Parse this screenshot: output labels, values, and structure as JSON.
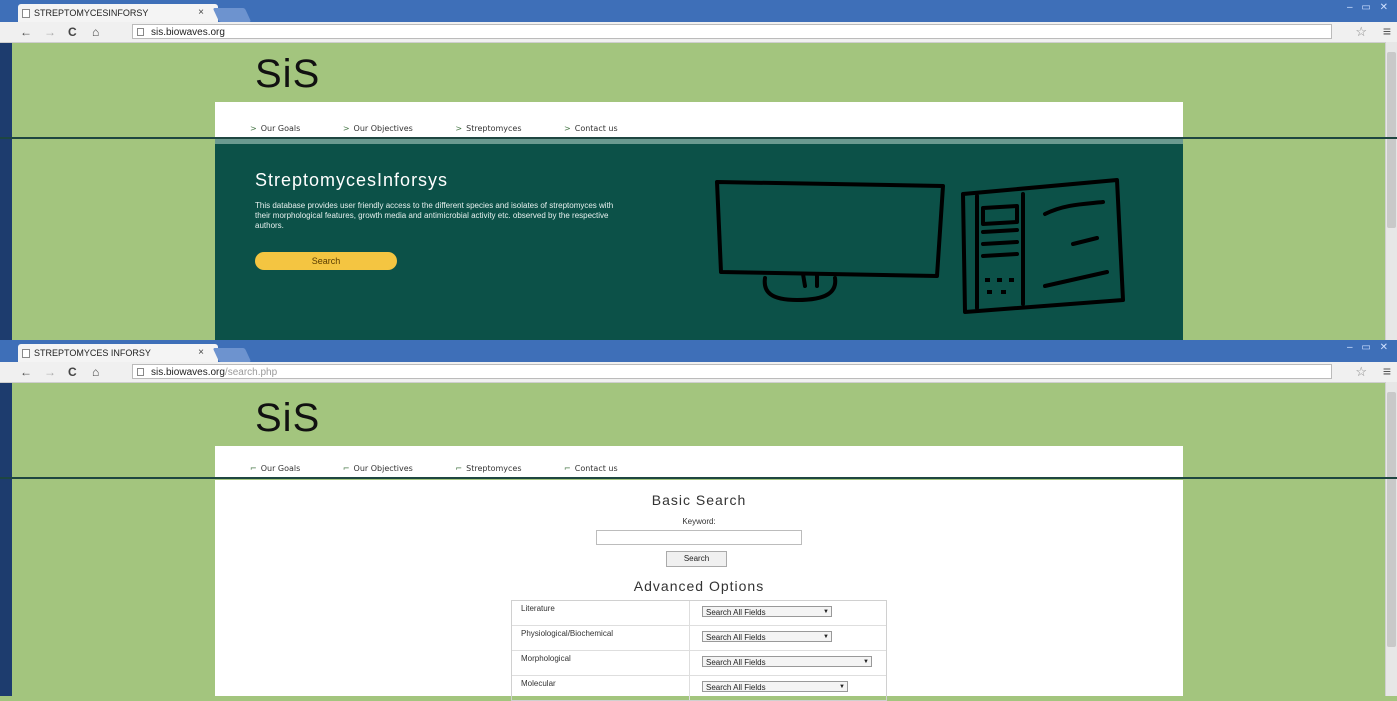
{
  "screen1": {
    "tab_title": "STREPTOMYCESINFORSY",
    "url_host": "sis.biowaves.org",
    "url_path": "",
    "logo": "SiS",
    "nav": [
      "Our Goals",
      "Our Objectives",
      "Streptomyces",
      "Contact us"
    ],
    "hero": {
      "title": "StreptomycesInforsys",
      "description": "This database provides user friendly access to the different species and isolates of streptomyces with their morphological features, growth media and antimicrobial activity etc. observed by the respective authors.",
      "button": "Search"
    }
  },
  "screen2": {
    "tab_title": "STREPTOMYCES INFORSY",
    "url_host": "sis.biowaves.org",
    "url_path": "/search.php",
    "logo": "SiS",
    "nav": [
      "Our Goals",
      "Our Objectives",
      "Streptomyces",
      "Contact us"
    ],
    "basic_search": {
      "heading": "Basic Search",
      "keyword_label": "Keyword:",
      "keyword_value": "",
      "button": "Search"
    },
    "advanced": {
      "heading": "Advanced Options",
      "rows": [
        {
          "label": "Literature",
          "value": "Search All Fields"
        },
        {
          "label": "Physiological/Biochemical",
          "value": "Search All Fields"
        },
        {
          "label": "Morphological",
          "value": "Search All Fields"
        },
        {
          "label": "Molecular",
          "value": "Search All Fields"
        }
      ]
    }
  },
  "chrome": {
    "close_glyph": "×",
    "window_controls": "–  ▭  ✕",
    "back_glyph": "←",
    "forward_glyph": "→",
    "reload_glyph": "C",
    "home_glyph": "⌂",
    "star_glyph": "☆",
    "menu_glyph": "≡",
    "nav_arrow_glyph": ">",
    "nav_arrow_glyph_alt": "⌐",
    "dropdown_glyph": "▼"
  },
  "colors": {
    "page_bg": "#a3c57e",
    "hero_bg": "#0c5148",
    "button_yellow": "#f4c541",
    "tab_strip": "#3e6fb8"
  }
}
